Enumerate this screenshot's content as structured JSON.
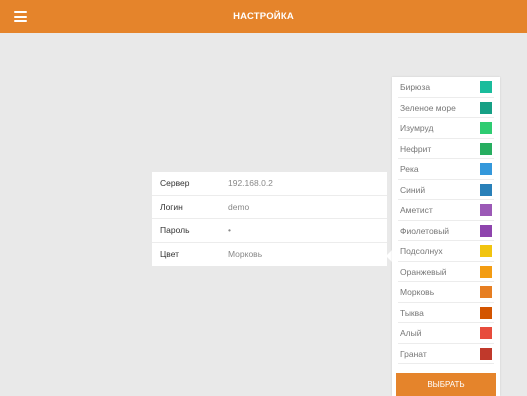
{
  "header": {
    "title": "НАСТРОЙКА",
    "menu_icon": "hamburger-menu-icon",
    "background": "#e5842b"
  },
  "settings": {
    "server": {
      "label": "Сервер",
      "value": "192.168.0.2"
    },
    "login": {
      "label": "Логин",
      "value": "demo"
    },
    "password": {
      "label": "Пароль",
      "value": "•"
    },
    "color": {
      "label": "Цвет",
      "value": "Морковь"
    }
  },
  "picker": {
    "colors": [
      {
        "name": "Бирюза",
        "hex": "#1abc9c"
      },
      {
        "name": "Зеленое море",
        "hex": "#16a085"
      },
      {
        "name": "Изумруд",
        "hex": "#2ecc71"
      },
      {
        "name": "Нефрит",
        "hex": "#27ae60"
      },
      {
        "name": "Река",
        "hex": "#3498db"
      },
      {
        "name": "Синий",
        "hex": "#2980b9"
      },
      {
        "name": "Аметист",
        "hex": "#9b59b6"
      },
      {
        "name": "Фиолетовый",
        "hex": "#8e44ad"
      },
      {
        "name": "Подсолнух",
        "hex": "#f1c40f"
      },
      {
        "name": "Оранжевый",
        "hex": "#f39c12"
      },
      {
        "name": "Морковь",
        "hex": "#e67e22"
      },
      {
        "name": "Тыква",
        "hex": "#d35400"
      },
      {
        "name": "Алый",
        "hex": "#e74c3c"
      },
      {
        "name": "Гранат",
        "hex": "#c0392b"
      }
    ],
    "select_label": "ВЫБРАТЬ"
  }
}
